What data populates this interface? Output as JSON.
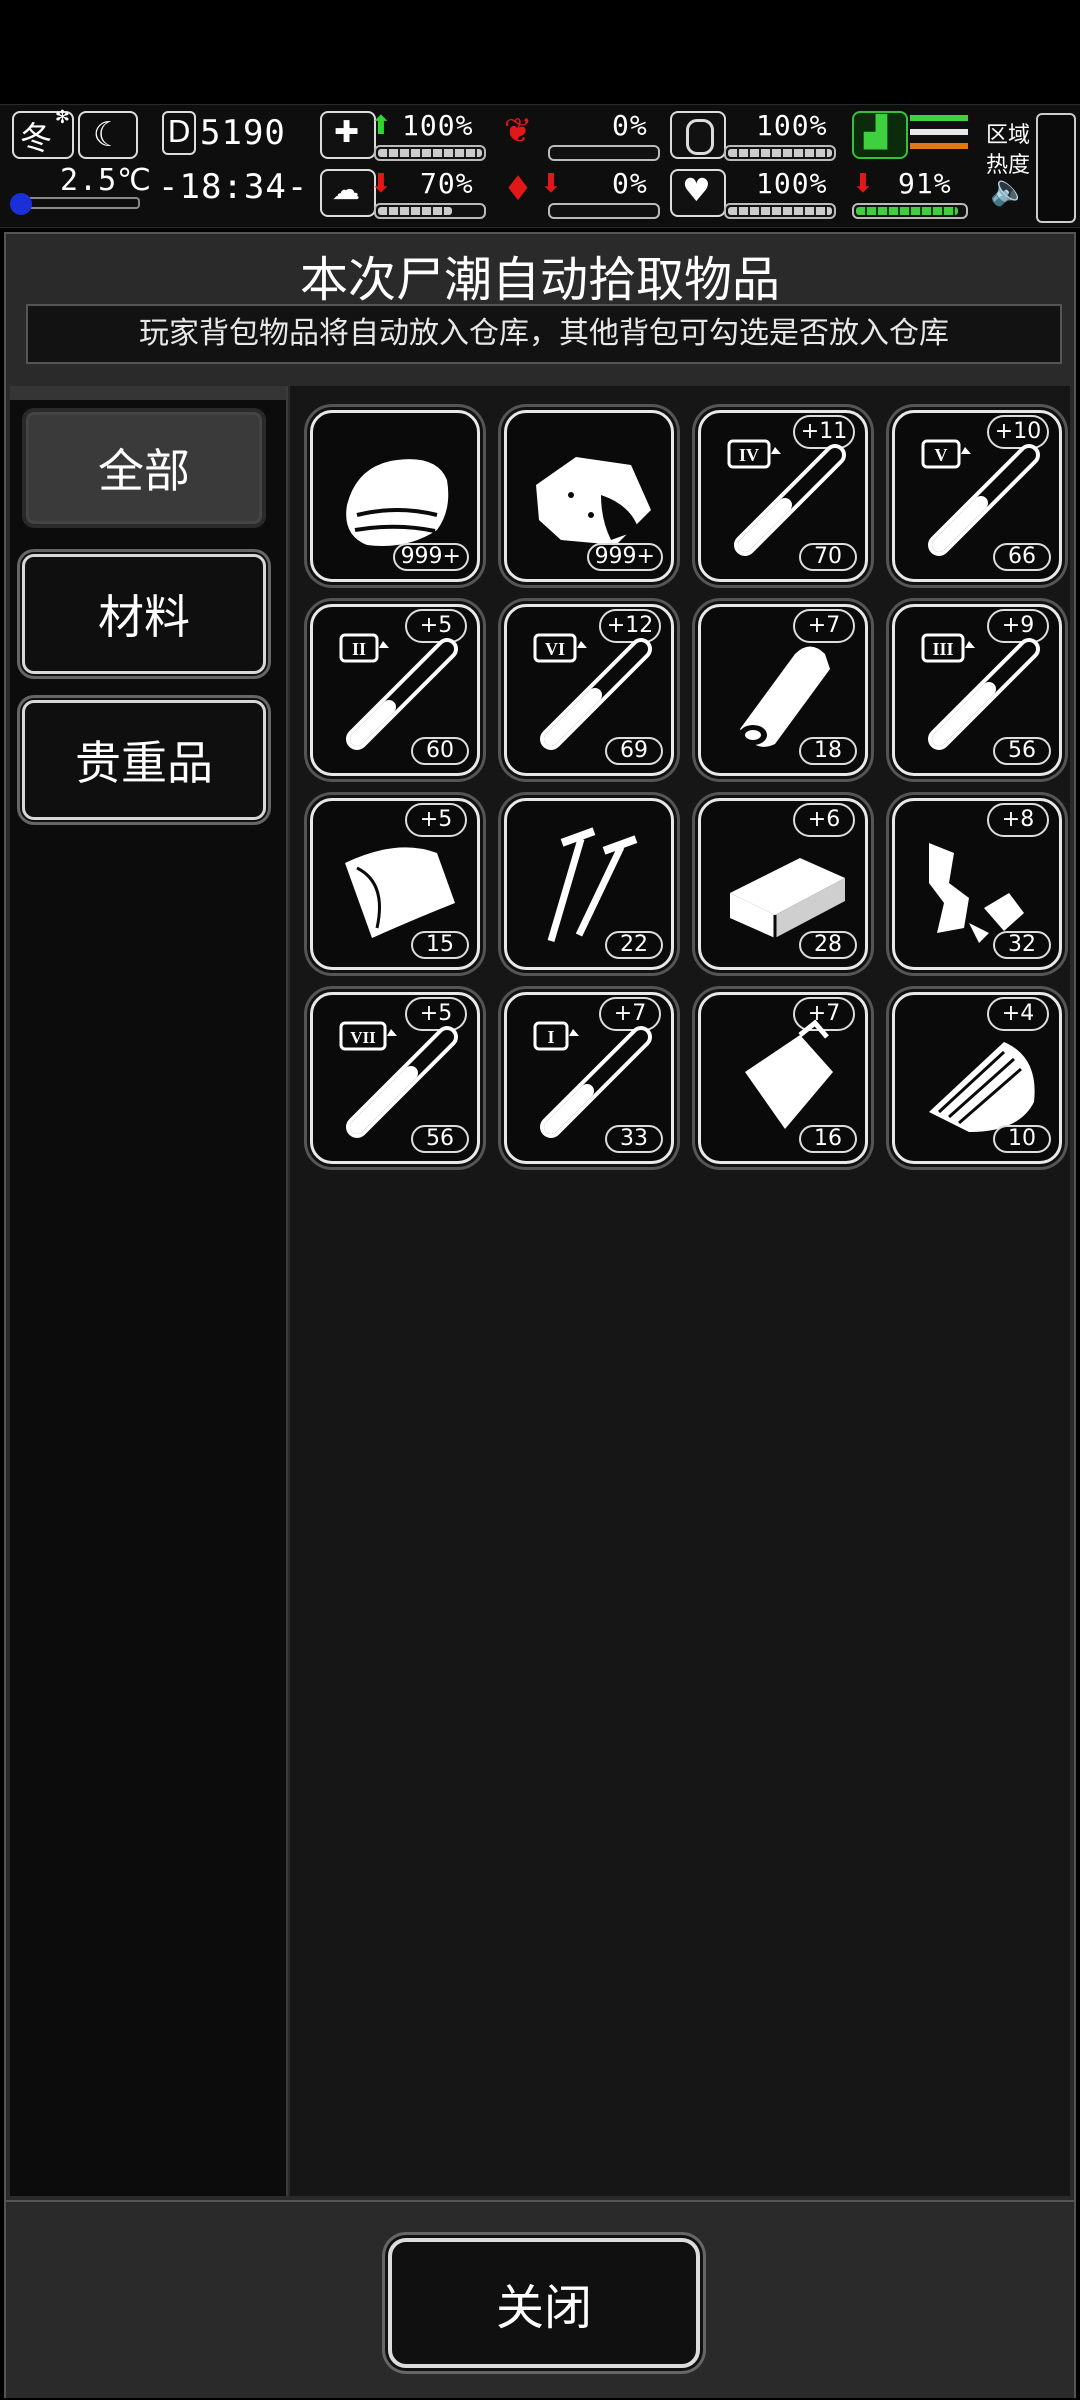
{
  "status_bar": {
    "season": "冬",
    "temperature": "2.5℃",
    "day_counter": "5190",
    "clock": "-18:34-",
    "stats_row1": [
      {
        "name": "health-icon",
        "arrow": "up",
        "value": "100%"
      },
      {
        "name": "stomach-icon",
        "arrow": "",
        "value": "0%"
      },
      {
        "name": "pill-icon",
        "arrow": "",
        "value": "100%"
      }
    ],
    "stats_row2": [
      {
        "name": "brain-icon",
        "arrow": "down",
        "value": "70%"
      },
      {
        "name": "blood-drop-icon",
        "arrow": "down",
        "value": "0%"
      },
      {
        "name": "heart-icon",
        "arrow": "",
        "value": "100%"
      }
    ],
    "boot_value": "91%",
    "zone_heat_label_1": "区域",
    "zone_heat_label_2": "热度"
  },
  "dialog": {
    "title": "本次尸潮自动拾取物品",
    "subtitle": "玩家背包物品将自动放入仓库，其他背包可勾选是否放入仓库"
  },
  "sidebar": {
    "tabs": [
      {
        "label": "全部",
        "active": true
      },
      {
        "label": "材料",
        "active": false
      },
      {
        "label": "贵重品",
        "active": false
      }
    ]
  },
  "items": [
    {
      "icon": "cloth-icon",
      "bonus": "",
      "count": "999+"
    },
    {
      "icon": "meat-icon",
      "bonus": "",
      "count": "999+"
    },
    {
      "icon": "syringe-iv-icon",
      "level": "IV",
      "bonus": "+11",
      "count": "70"
    },
    {
      "icon": "syringe-v-icon",
      "level": "V",
      "bonus": "+10",
      "count": "66"
    },
    {
      "icon": "syringe-ii-icon",
      "level": "II",
      "bonus": "+5",
      "count": "60"
    },
    {
      "icon": "syringe-vi-icon",
      "level": "VI",
      "bonus": "+12",
      "count": "69"
    },
    {
      "icon": "wood-log-icon",
      "bonus": "+7",
      "count": "18"
    },
    {
      "icon": "syringe-iii-icon",
      "level": "III",
      "bonus": "+9",
      "count": "56"
    },
    {
      "icon": "leather-icon",
      "bonus": "+5",
      "count": "15"
    },
    {
      "icon": "nails-icon",
      "bonus": "",
      "count": "22"
    },
    {
      "icon": "brick-icon",
      "bonus": "+6",
      "count": "28"
    },
    {
      "icon": "scrap-icon",
      "bonus": "+8",
      "count": "32"
    },
    {
      "icon": "syringe-vii-icon",
      "level": "VII",
      "bonus": "+5",
      "count": "56"
    },
    {
      "icon": "syringe-i-icon",
      "level": "I",
      "bonus": "+7",
      "count": "33"
    },
    {
      "icon": "plastic-bag-icon",
      "bonus": "+7",
      "count": "16"
    },
    {
      "icon": "wood-planks-icon",
      "bonus": "+4",
      "count": "10"
    }
  ],
  "footer": {
    "close_label": "关闭"
  }
}
